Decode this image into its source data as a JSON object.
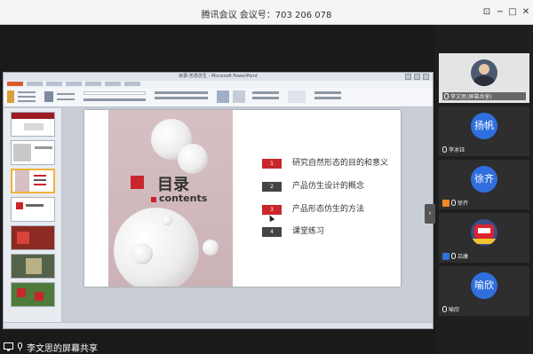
{
  "window": {
    "title": "腾讯会议 会议号：703 206 078",
    "controls": [
      "pin-icon",
      "minimize-icon",
      "maximize-icon",
      "close-icon"
    ]
  },
  "share": {
    "sharer_label": "李文思的屏幕共享",
    "ppt": {
      "title_bar": "目录-形态仿生 - Microsoft PowerPoint"
    },
    "slide": {
      "heading": "目录",
      "subheading": "contents",
      "items": [
        {
          "num": "1",
          "text": "研究自然形态的目的和意义",
          "color": "#c9262c"
        },
        {
          "num": "2",
          "text": "产品仿生设计的概念",
          "color": "#444444"
        },
        {
          "num": "3",
          "text": "产品形态仿生的方法",
          "color": "#c9262c"
        },
        {
          "num": "4",
          "text": "课堂练习",
          "color": "#444444"
        }
      ]
    }
  },
  "participants": [
    {
      "name": "李文思(屏幕共享)",
      "type": "video",
      "icon": "user-photo"
    },
    {
      "name": "李冰钰",
      "avatar_text": "扬帆",
      "avatar_color": "#2f6fde"
    },
    {
      "name": "徐齐",
      "avatar_text": "徐齐",
      "avatar_color": "#2f6fde"
    },
    {
      "name": "吕康",
      "avatar_text": "",
      "avatar_color": "#3b4f86"
    },
    {
      "name": "喻欣",
      "avatar_text": "喻欣",
      "avatar_color": "#2f6fde"
    }
  ],
  "colors": {
    "accent_red": "#c9262c",
    "avatar_blue": "#2f6fde",
    "panel_bg": "#1f1f1f"
  }
}
